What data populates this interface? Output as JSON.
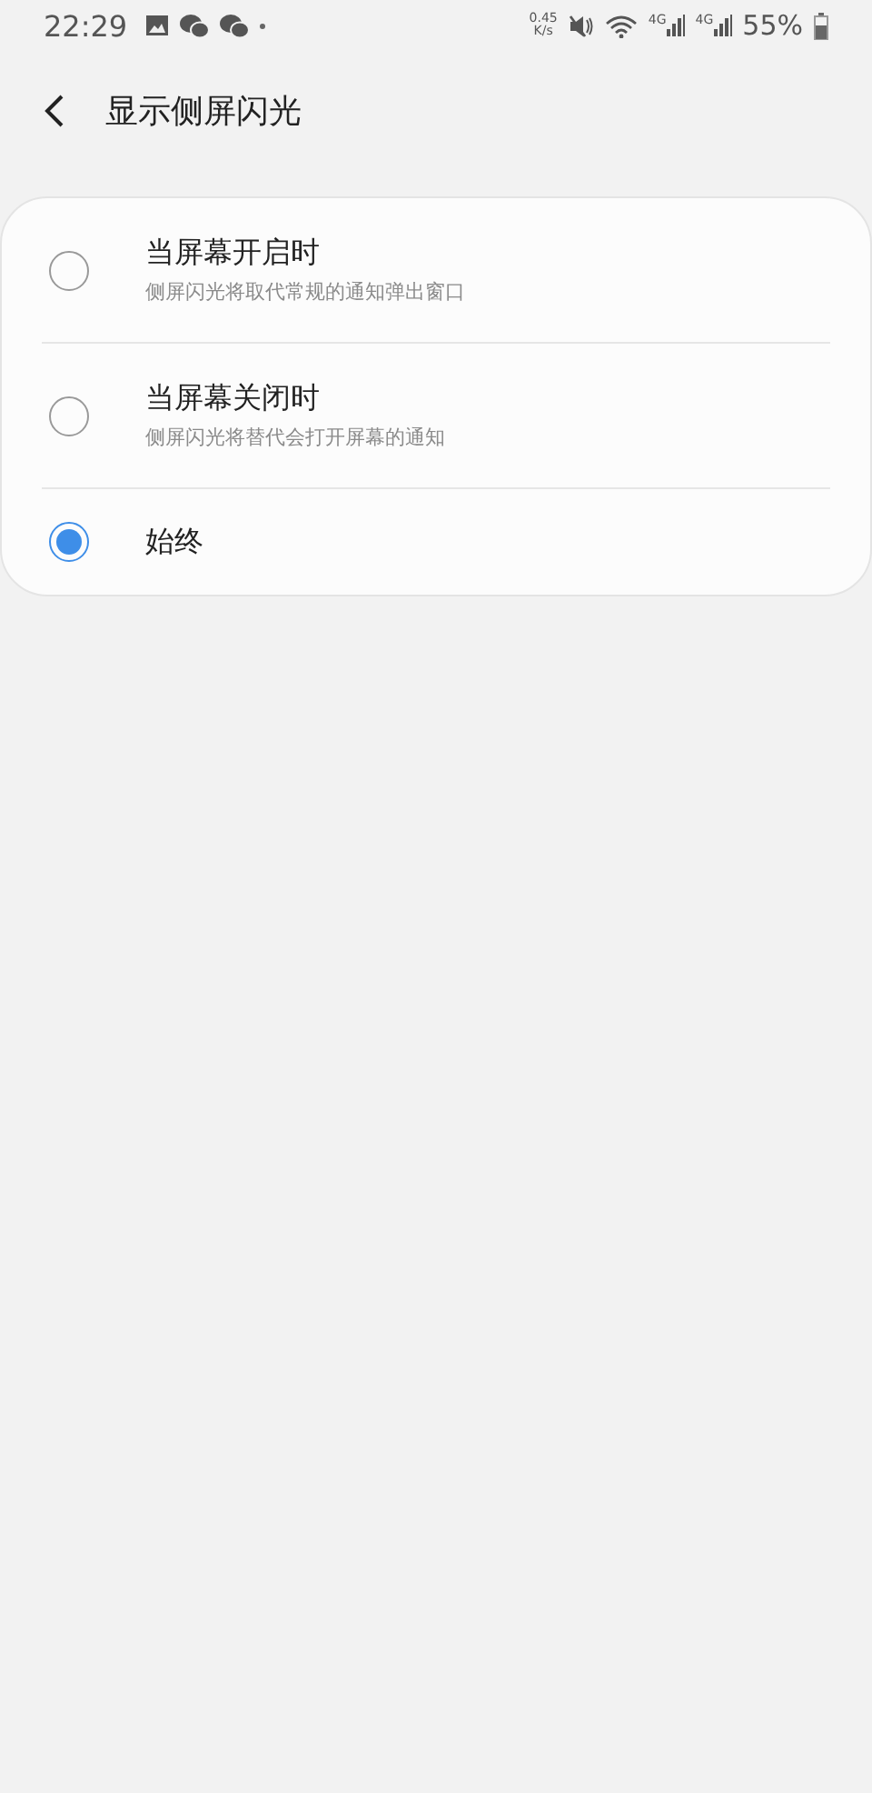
{
  "status_bar": {
    "time": "22:29",
    "net_speed": [
      "0.45",
      "K/s"
    ],
    "network_labels": [
      "4G",
      "4G"
    ],
    "battery": "55%"
  },
  "header": {
    "title": "显示侧屏闪光"
  },
  "options": [
    {
      "title": "当屏幕开启时",
      "subtitle": "侧屏闪光将取代常规的通知弹出窗口",
      "selected": false
    },
    {
      "title": "当屏幕关闭时",
      "subtitle": "侧屏闪光将替代会打开屏幕的通知",
      "selected": false
    },
    {
      "title": "始终",
      "selected": true
    }
  ]
}
